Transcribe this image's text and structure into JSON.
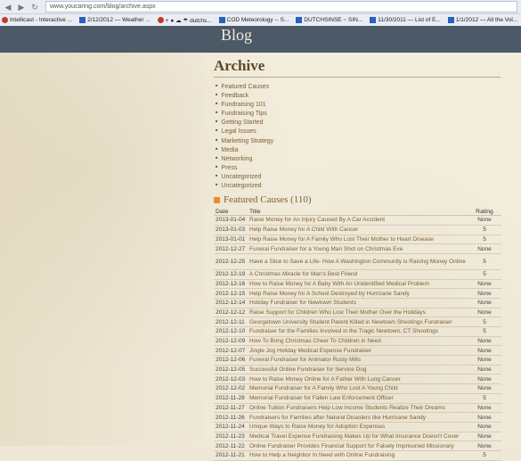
{
  "browser": {
    "url": "www.youcaring.com/blog/archive.aspx",
    "bookmarks": [
      {
        "label": "Intellicast - Interactive ...",
        "icon": "red"
      },
      {
        "label": "2/12/2012 — Weather ...",
        "icon": "blue"
      },
      {
        "label": "+ ● ☁ ☂ dutchs...",
        "icon": "red"
      },
      {
        "label": "COD Meteorology -- S...",
        "icon": "blue"
      },
      {
        "label": "DUTCHSINSE ~ SIN...",
        "icon": "blue"
      },
      {
        "label": "11/30/2011 — List of E...",
        "icon": "blue"
      },
      {
        "label": "1/1/2012 — All the Vol...",
        "icon": "blue"
      }
    ]
  },
  "header": {
    "blog_title": "Blog"
  },
  "archive": {
    "title": "Archive",
    "categories": [
      "Featured Causes",
      "Feedback",
      "Fundraising 101",
      "Fundraising Tips",
      "Getting Started",
      "Legal Issues",
      "Marketing Strategy",
      "Media",
      "Networking",
      "Press",
      "Uncategorized",
      "Uncategorized"
    ]
  },
  "featured": {
    "title": "Featured Causes (110)",
    "columns": {
      "date": "Date",
      "title": "Title",
      "rating": "Rating"
    },
    "rows": [
      {
        "date": "2013-01-04",
        "title": "Raise Money for An Injury Caused By A Car Accident",
        "rating": "None"
      },
      {
        "date": "2013-01-03",
        "title": "Help Raise Money for A Child With Cancer",
        "rating": "5"
      },
      {
        "date": "2013-01-01",
        "title": "Help Raise Money for A Family Who Lost Their Mother to Heart Disease",
        "rating": "5"
      },
      {
        "date": "2012-12-27",
        "title": "Funeral Fundraiser for a Young Man Shot on Christmas Eve",
        "rating": "None"
      },
      {
        "date": "2012-12-25",
        "title": "Have a Slice to Save a Life- How A Washington Community is Raising Money Online",
        "rating": "5"
      },
      {
        "date": "2012-12-19",
        "title": "A Christmas Miracle for Man's Best Friend",
        "rating": "5"
      },
      {
        "date": "2012-12-16",
        "title": "How to Raise Money for A Baby With An Unidentified Medical Problem",
        "rating": "None"
      },
      {
        "date": "2012-12-15",
        "title": "Help Raise Money for A School Destroyed by Hurricane Sandy",
        "rating": "None"
      },
      {
        "date": "2012-12-14",
        "title": "Holiday Fundraiser for Newtown Students",
        "rating": "None"
      },
      {
        "date": "2012-12-12",
        "title": "Raise Support for Children Who Lost Their Mother Over the Holidays",
        "rating": "None"
      },
      {
        "date": "2012-12-11",
        "title": "Georgetown University Student Parent Killed in Newtown Shootings Fundraiser",
        "rating": "5"
      },
      {
        "date": "2012-12-10",
        "title": "Fundraiser for the Families Involved in the Tragic Newtown, CT Shootings",
        "rating": "5"
      },
      {
        "date": "2012-12-09",
        "title": "How To Bring Christmas Cheer To Children in Need",
        "rating": "None"
      },
      {
        "date": "2012-12-07",
        "title": "Jingle Jog Holiday Medical Expense Fundraiser",
        "rating": "None"
      },
      {
        "date": "2012-12-06",
        "title": "Funeral Fundraiser for Animator Rusty Mills",
        "rating": "None"
      },
      {
        "date": "2012-12-05",
        "title": "Successful Online Fundraiser for Service Dog",
        "rating": "None"
      },
      {
        "date": "2012-12-03",
        "title": "How to Raise Money Online for A Father With Lung Cancer",
        "rating": "None"
      },
      {
        "date": "2012-12-02",
        "title": "Memorial Fundraiser for A Family Who Lost A Young Child",
        "rating": "None"
      },
      {
        "date": "2012-11-28",
        "title": "Memorial Fundraiser for Fallen Law Enforcement Officer",
        "rating": "5"
      },
      {
        "date": "2012-11-27",
        "title": "Online Tuition Fundraisers Help Low Income Students Realize Their Dreams",
        "rating": "None"
      },
      {
        "date": "2012-11-26",
        "title": "Fundraisers for Families after Natural Disasters like Hurricane Sandy",
        "rating": "None"
      },
      {
        "date": "2012-11-24",
        "title": "Unique Ways to Raise Money for Adoption Expenses",
        "rating": "None"
      },
      {
        "date": "2012-11-23",
        "title": "Medical Travel Expense Fundraising Makes Up for What Insurance Doesn't Cover",
        "rating": "None"
      },
      {
        "date": "2012-11-22",
        "title": "Online Fundraiser Provides Financial Support for Falsely Imprisoned Missionary",
        "rating": "None"
      },
      {
        "date": "2012-11-21",
        "title": "How to Help a Neighbor In Need with Online Fundraising",
        "rating": "5"
      }
    ]
  }
}
